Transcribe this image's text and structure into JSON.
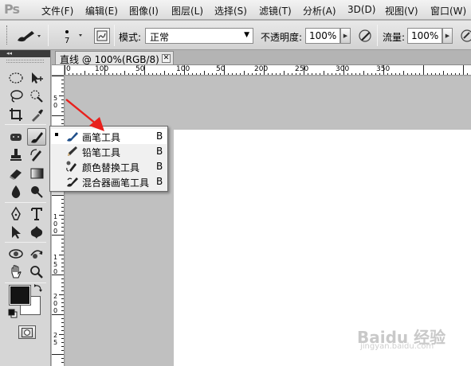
{
  "app": {
    "logo": "Ps"
  },
  "menu": [
    "文件(F)",
    "编辑(E)",
    "图像(I)",
    "图层(L)",
    "选择(S)",
    "滤镜(T)",
    "分析(A)",
    "3D(D)",
    "视图(V)",
    "窗口(W)"
  ],
  "options": {
    "brush_size": "7",
    "mode_label": "模式:",
    "mode_value": "正常",
    "opacity_label": "不透明度:",
    "opacity_value": "100%",
    "flow_label": "流量:",
    "flow_value": "100%"
  },
  "document": {
    "tab_title": "直线 @ 100%(RGB/8) *",
    "close_glyph": "✕"
  },
  "ruler": {
    "top_labels": [
      "0",
      "100",
      "50",
      "100",
      "50",
      "200",
      "250",
      "300",
      "350"
    ],
    "left_labels": [
      "5",
      "0",
      "1",
      "0",
      "0",
      "1",
      "5",
      "0",
      "2",
      "0",
      "0",
      "2",
      "5"
    ]
  },
  "flyout": {
    "items": [
      {
        "label": "画笔工具",
        "shortcut": "B",
        "icon": "brush-icon",
        "selected": true
      },
      {
        "label": "铅笔工具",
        "shortcut": "B",
        "icon": "pencil-icon",
        "selected": false
      },
      {
        "label": "颜色替换工具",
        "shortcut": "B",
        "icon": "color-replacement-icon",
        "selected": false
      },
      {
        "label": "混合器画笔工具",
        "shortcut": "B",
        "icon": "mixer-brush-icon",
        "selected": false
      }
    ]
  },
  "tools": [
    "marquee-icon",
    "move-icon",
    "lasso-icon",
    "quick-selection-icon",
    "crop-icon",
    "eyedropper-icon",
    "spot-healing-icon",
    "brush-icon",
    "clone-stamp-icon",
    "history-brush-icon",
    "eraser-icon",
    "gradient-icon",
    "blur-icon",
    "dodge-icon",
    "pen-icon",
    "type-icon",
    "path-selection-icon",
    "shape-icon",
    "3d-rotate-icon",
    "3d-orbit-icon",
    "hand-icon",
    "zoom-icon"
  ],
  "colors": {
    "foreground": "#141414",
    "background": "#ffffff",
    "annotation_arrow": "#e8201c"
  },
  "watermark": {
    "text": "Baidu 经验",
    "url": "jingyan.baidu.com"
  }
}
